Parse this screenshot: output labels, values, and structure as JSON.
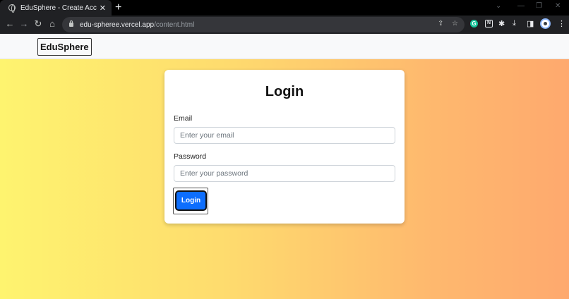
{
  "browser": {
    "tab_title": "EduSphere - Create Account",
    "new_tab_symbol": "+",
    "url_host": "edu-spheree.vercel.app",
    "url_path": "/content.html",
    "icons": [
      "back-icon",
      "forward-icon",
      "reload-icon",
      "home-icon",
      "lock-icon",
      "share-icon",
      "star-icon",
      "grammarly-extension-icon",
      "notion-extension-icon",
      "puzzle-icon",
      "download-icon",
      "sidepanel-icon",
      "profile-icon",
      "more-icon"
    ]
  },
  "navbar": {
    "brand": "EduSphere"
  },
  "login": {
    "title": "Login",
    "email_label": "Email",
    "email_placeholder": "Enter your email",
    "email_value": "",
    "password_label": "Password",
    "password_placeholder": "Enter your password",
    "password_value": "",
    "submit_label": "Login"
  },
  "colors": {
    "gradient_start": "#fef46f",
    "gradient_end": "#fea96e",
    "button": "#0d6efd",
    "card": "#ffffff"
  }
}
